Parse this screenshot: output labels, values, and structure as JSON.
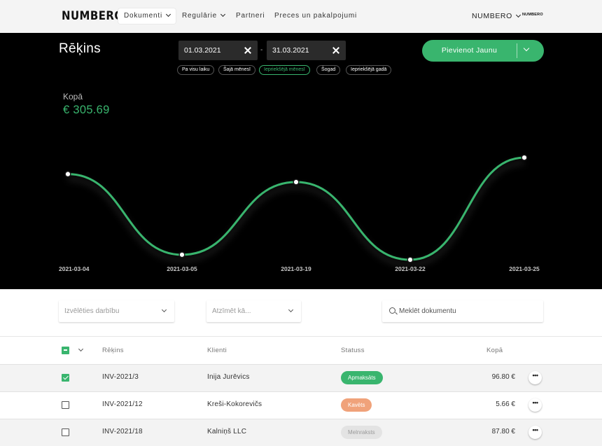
{
  "app": {
    "logo": "NUMBERO",
    "nav": [
      {
        "label": "Dokumenti",
        "has_dropdown": true,
        "active": true
      },
      {
        "label": "Regulārie",
        "has_dropdown": true,
        "active": false
      },
      {
        "label": "Partneri",
        "has_dropdown": false,
        "active": false
      },
      {
        "label": "Preces un pakalpojumi",
        "has_dropdown": false,
        "active": false
      }
    ],
    "account_label": "NUMBERO",
    "account_logo": "NUMBERO"
  },
  "hero": {
    "title": "Rēķins",
    "date_from": "01.03.2021",
    "date_to": "31.03.2021",
    "date_separator": "-",
    "quick_ranges": [
      {
        "label": "Pa visu laiku",
        "active": false
      },
      {
        "label": "Šajā mēnesī",
        "active": false
      },
      {
        "label": "Iepriekšējā mēnesī",
        "active": true
      },
      {
        "label": "Šogad",
        "active": false
      },
      {
        "label": "Iepriekšējā gadā",
        "active": false
      }
    ],
    "add_button_label": "Pievienot Jaunu",
    "total_label": "Kopā",
    "total_value": "€ 305.69"
  },
  "chart_data": {
    "type": "line",
    "x": [
      "2021-03-04",
      "2021-03-05",
      "2021-03-19",
      "2021-03-22",
      "2021-03-25"
    ],
    "series": [
      {
        "values": [
          96.8,
          5.66,
          87.8,
          0.0,
          115.43
        ]
      }
    ],
    "ylim": [
      0,
      125
    ],
    "grid": false,
    "line_color": "#39b56e",
    "marker_fill": "#ffffff"
  },
  "filters": {
    "action_placeholder": "Izvēlēties darbību",
    "mark_placeholder": "Atzīmēt kā...",
    "search_placeholder": "Meklēt dokumentu"
  },
  "table": {
    "columns": [
      "Rēķins",
      "Klienti",
      "Statuss",
      "Kopā"
    ],
    "rows": [
      {
        "checked": true,
        "invoice": "INV-2021/3",
        "client": "Inija Jurēvics",
        "status": "Apmaksāts",
        "status_color": "#39b56e",
        "amount": "96.80 €"
      },
      {
        "checked": false,
        "invoice": "INV-2021/12",
        "client": "Kreši-Kokorevičs",
        "status": "Kavēts",
        "status_color": "#f0a27a",
        "amount": "5.66 €"
      },
      {
        "checked": false,
        "invoice": "INV-2021/18",
        "client": "Kalniņš LLC",
        "status": "Melnraksts",
        "status_color": "#e3e3e3",
        "amount": "87.80 €"
      }
    ],
    "more_glyph": "•••"
  },
  "colors": {
    "accent": "#39b56e",
    "late": "#f0a27a",
    "draft": "#e3e3e3",
    "hero_bg": "#000000"
  }
}
